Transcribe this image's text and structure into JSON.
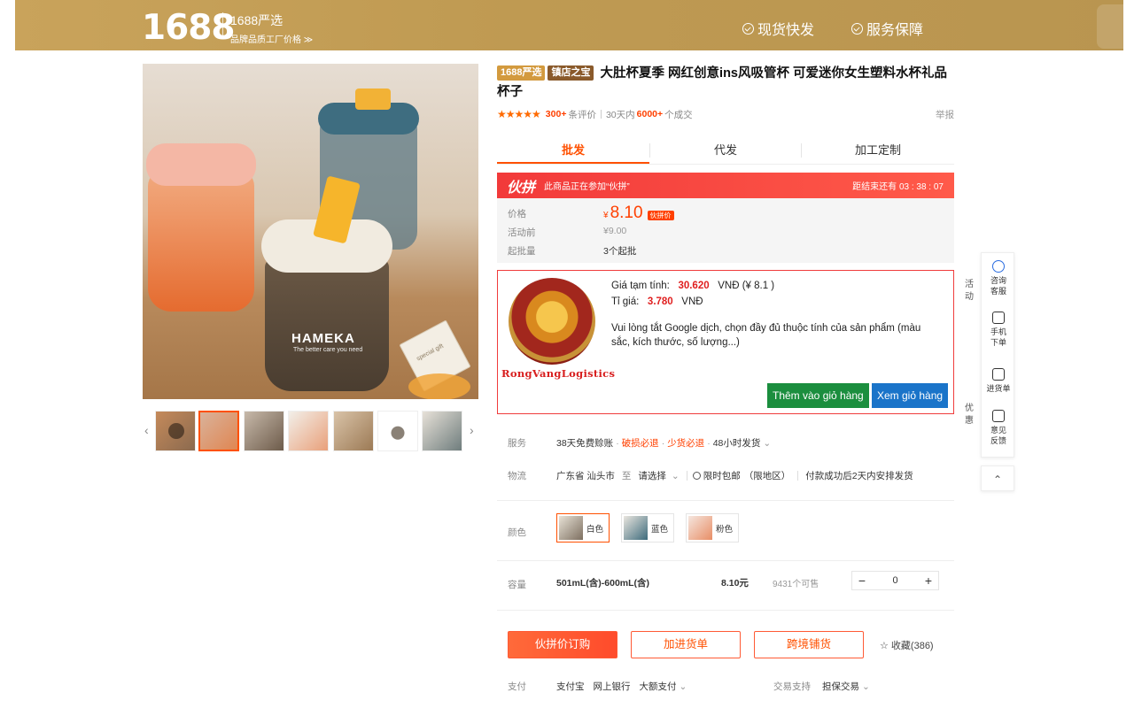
{
  "header": {
    "logo": "1688",
    "brand_title": "1688严选",
    "brand_subtitle": "品牌品质工厂价格 ≫",
    "badges": [
      "现货快发",
      "服务保障"
    ]
  },
  "product": {
    "tags": [
      "1688严选",
      "镇店之宝"
    ],
    "title": "大肚杯夏季 网红创意ins风吸管杯 可爱迷你女生塑料水杯礼品杯子",
    "stars": "★★★★★",
    "review_count": "300+",
    "review_label": "条评价",
    "sales_period": "30天内",
    "sales_count": "6000+",
    "sales_label": "个成交",
    "report": "举报",
    "image_text": "HAMEKA",
    "image_slogan": "The better care you need",
    "image_gift": "special gift"
  },
  "gallery": {
    "prev": "‹",
    "next": "›"
  },
  "tabs": [
    "批发",
    "代发",
    "加工定制"
  ],
  "promo": {
    "brand": "伙拼",
    "text": "此商品正在参加“伙拼”",
    "countdown": "距结束还有 03 : 38 : 07"
  },
  "price_box": {
    "price_label": "价格",
    "currency": "¥",
    "price": "8.10",
    "price_badge": "伙拼价",
    "before_label": "活动前",
    "before_value": "¥9.00",
    "moq_label": "起批量",
    "moq_value": "3个起批"
  },
  "plugin": {
    "brand_name": "RongVangLogistics",
    "est_label": "Giá tạm tính:",
    "est_value": "30.620",
    "est_unit": "VNĐ (¥ 8.1 )",
    "rate_label": "Tỉ giá:",
    "rate_value": "3.780",
    "rate_unit": "VNĐ",
    "note": "Vui lòng tắt Google dịch, chọn đầy đủ thuộc tính của sản phẩm (màu sắc, kích thước, số lượng...)",
    "add_cart": "Thêm vào giỏ hàng",
    "view_cart": "Xem giỏ hàng"
  },
  "service": {
    "label": "服务",
    "items": [
      "38天免费赊账",
      "破损必退",
      "少货必退",
      "48小时发货"
    ],
    "chevron": "⌄"
  },
  "logistics": {
    "label": "物流",
    "from": "广东省 汕头市",
    "to_word": "至",
    "select": "请选择",
    "chevron": "⌄",
    "free_shipping": "限时包邮",
    "free_area": "（限地区）",
    "ship_time": "付款成功后2天内安排发货"
  },
  "color": {
    "label": "颜色",
    "options": [
      "白色",
      "蓝色",
      "粉色"
    ]
  },
  "capacity": {
    "label": "容量",
    "option": "501mL(含)-600mL(含)",
    "price": "8.10元",
    "stock": "9431个可售",
    "qty": "0",
    "minus": "−",
    "plus": "+"
  },
  "actions": {
    "buy": "伙拼价订购",
    "add_list": "加进货单",
    "cross_border": "跨境铺货",
    "favorite": "☆ 收藏(386)"
  },
  "payment": {
    "label": "支付",
    "methods": [
      "支付宝",
      "网上银行",
      "大额支付"
    ],
    "chevron": "⌄",
    "trade_label": "交易支持",
    "trade_value": "担保交易"
  },
  "sidebar": {
    "items": [
      "咨询客服",
      "手机下单",
      "进货单",
      "意见反馈"
    ],
    "back_top": "⌃"
  },
  "peek_text": {
    "a": "活",
    "b": "动",
    "c": "优",
    "d": "惠"
  }
}
